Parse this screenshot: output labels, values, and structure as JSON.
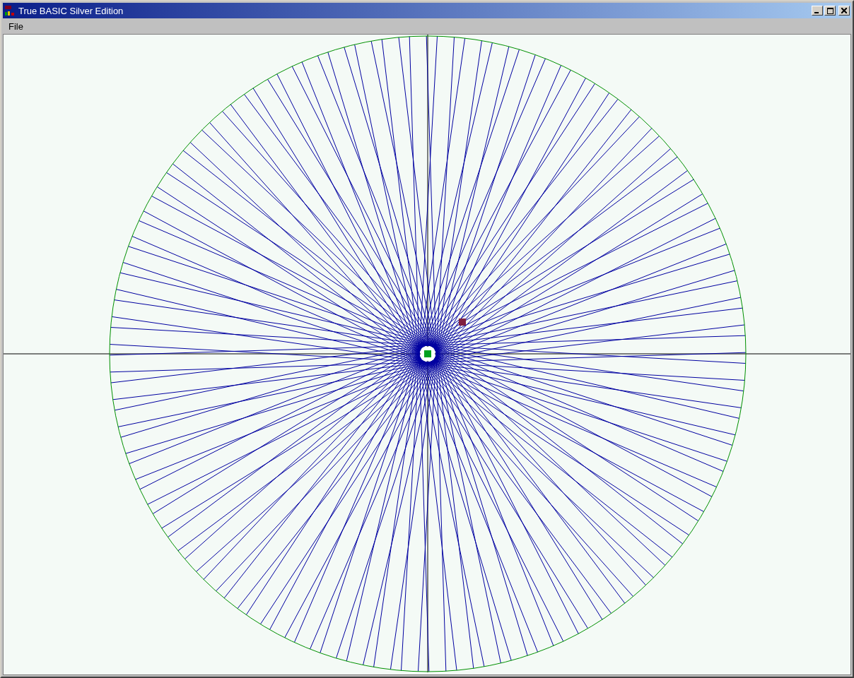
{
  "window": {
    "title": "True BASIC Silver Edition"
  },
  "menu_bar": {
    "items": [
      {
        "label": "File"
      }
    ]
  }
}
